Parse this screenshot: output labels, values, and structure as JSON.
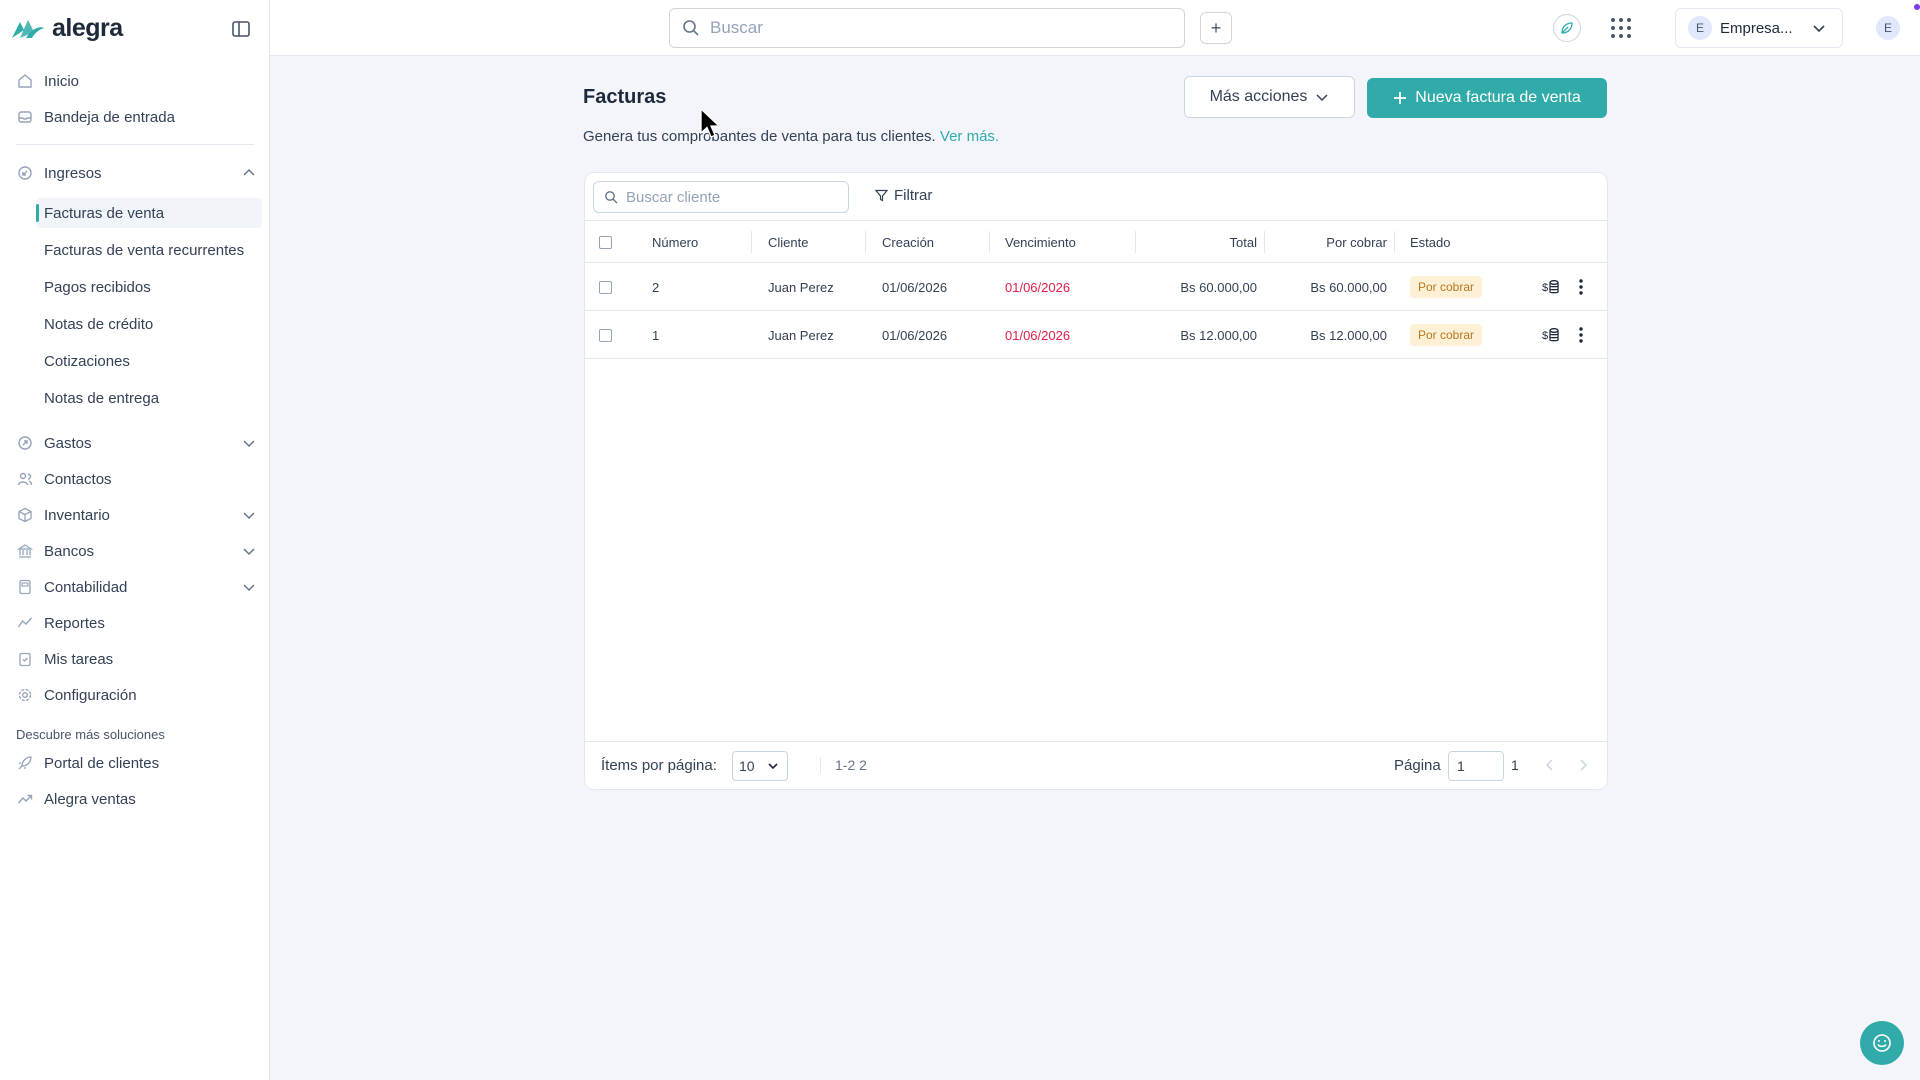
{
  "brand": {
    "name": "alegra",
    "accent": "#30aba9"
  },
  "topbar": {
    "search_placeholder": "Buscar",
    "add_label": "+",
    "company_initial": "E",
    "company_name": "Empresa...",
    "user_initial": "E"
  },
  "sidebar": {
    "items": [
      {
        "label": "Inicio",
        "icon": "home-icon"
      },
      {
        "label": "Bandeja de entrada",
        "icon": "inbox-icon"
      },
      {
        "label": "Ingresos",
        "icon": "income-icon"
      },
      {
        "label": "Gastos",
        "icon": "expenses-icon"
      },
      {
        "label": "Contactos",
        "icon": "contacts-icon"
      },
      {
        "label": "Inventario",
        "icon": "inventory-icon"
      },
      {
        "label": "Bancos",
        "icon": "bank-icon"
      },
      {
        "label": "Contabilidad",
        "icon": "accounting-icon"
      },
      {
        "label": "Reportes",
        "icon": "reports-icon"
      },
      {
        "label": "Mis tareas",
        "icon": "tasks-icon"
      },
      {
        "label": "Configuración",
        "icon": "settings-icon"
      }
    ],
    "income_subitems": [
      "Facturas de venta",
      "Facturas de venta recurrentes",
      "Pagos recibidos",
      "Notas de crédito",
      "Cotizaciones",
      "Notas de entrega"
    ],
    "discover_label": "Descubre más soluciones",
    "discover_items": [
      "Portal de clientes",
      "Alegra ventas"
    ]
  },
  "main": {
    "title": "Facturas",
    "description": "Genera tus comprobantes de venta para tus clientes.",
    "see_more": "Ver más.",
    "more_actions": "Más acciones",
    "new_invoice": "Nueva factura de venta",
    "client_search_placeholder": "Buscar cliente",
    "filter_label": "Filtrar",
    "columns": [
      "Número",
      "Cliente",
      "Creación",
      "Vencimiento",
      "Total",
      "Por cobrar",
      "Estado"
    ],
    "rows": [
      {
        "number": "2",
        "client": "Juan Perez",
        "created": "01/06/2026",
        "due": "01/06/2026",
        "total": "Bs 60.000,00",
        "pending": "Bs 60.000,00",
        "status": "Por cobrar"
      },
      {
        "number": "1",
        "client": "Juan Perez",
        "created": "01/06/2026",
        "due": "01/06/2026",
        "total": "Bs 12.000,00",
        "pending": "Bs 12.000,00",
        "status": "Por cobrar"
      }
    ],
    "footer": {
      "per_page_label": "Ítems por página:",
      "per_page_value": "10",
      "range": "1-2 2",
      "page_label": "Página",
      "page_value": "1",
      "page_total": "1"
    }
  }
}
